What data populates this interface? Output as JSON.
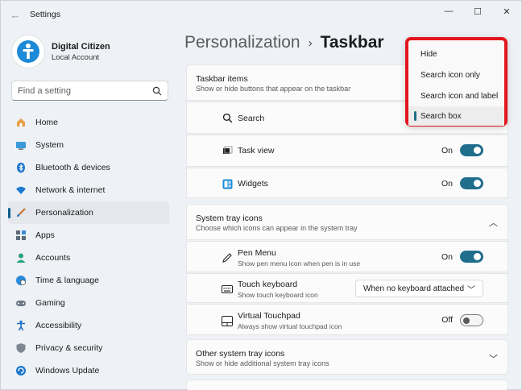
{
  "app": {
    "title": "Settings"
  },
  "window_controls": {
    "minimize": "—",
    "maximize": "☐",
    "close": "✕"
  },
  "user": {
    "name": "Digital Citizen",
    "account": "Local Account"
  },
  "search": {
    "placeholder": "Find a setting"
  },
  "nav": {
    "items": [
      {
        "label": "Home",
        "icon": "home-icon"
      },
      {
        "label": "System",
        "icon": "system-icon"
      },
      {
        "label": "Bluetooth & devices",
        "icon": "bluetooth-icon"
      },
      {
        "label": "Network & internet",
        "icon": "wifi-icon"
      },
      {
        "label": "Personalization",
        "icon": "brush-icon",
        "active": true
      },
      {
        "label": "Apps",
        "icon": "apps-icon"
      },
      {
        "label": "Accounts",
        "icon": "accounts-icon"
      },
      {
        "label": "Time & language",
        "icon": "globe-icon"
      },
      {
        "label": "Gaming",
        "icon": "gamepad-icon"
      },
      {
        "label": "Accessibility",
        "icon": "accessibility-icon"
      },
      {
        "label": "Privacy & security",
        "icon": "shield-icon"
      },
      {
        "label": "Windows Update",
        "icon": "update-icon"
      }
    ]
  },
  "breadcrumb": {
    "parent": "Personalization",
    "separator": "›",
    "current": "Taskbar"
  },
  "taskbar_items": {
    "title": "Taskbar items",
    "subtitle": "Show or hide buttons that appear on the taskbar",
    "search": {
      "label": "Search"
    },
    "task_view": {
      "label": "Task view",
      "state": "On",
      "on": true
    },
    "widgets": {
      "label": "Widgets",
      "state": "On",
      "on": true
    }
  },
  "system_tray": {
    "title": "System tray icons",
    "subtitle": "Choose which icons can appear in the system tray",
    "pen_menu": {
      "label": "Pen Menu",
      "sub": "Show pen menu icon when pen is in use",
      "state": "On",
      "on": true
    },
    "touch_keyboard": {
      "label": "Touch keyboard",
      "sub": "Show touch keyboard icon",
      "value": "When no keyboard attached"
    },
    "virtual_touchpad": {
      "label": "Virtual Touchpad",
      "sub": "Always show virtual touchpad icon",
      "state": "Off",
      "on": false
    }
  },
  "other_tray": {
    "title": "Other system tray icons",
    "subtitle": "Show or hide additional system tray icons"
  },
  "search_dropdown": {
    "options": [
      "Hide",
      "Search icon only",
      "Search icon and label",
      "Search box"
    ],
    "selected": "Search box"
  },
  "colors": {
    "accent": "#1f6e8c",
    "highlight": "#e3151f"
  }
}
